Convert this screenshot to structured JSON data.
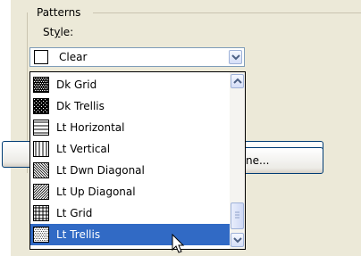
{
  "group": {
    "title": "Patterns"
  },
  "style": {
    "label_prefix": "St",
    "label_accel": "y",
    "label_suffix": "le:"
  },
  "combo": {
    "value": "Clear",
    "swatch": "clear"
  },
  "background_button": {
    "label": "ne..."
  },
  "dropdown": {
    "items": [
      {
        "label": "Dk Grid",
        "pattern": "dk-grid"
      },
      {
        "label": "Dk Trellis",
        "pattern": "dk-trellis"
      },
      {
        "label": "Lt Horizontal",
        "pattern": "lt-horizontal"
      },
      {
        "label": "Lt Vertical",
        "pattern": "lt-vertical"
      },
      {
        "label": "Lt Dwn Diagonal",
        "pattern": "lt-dwn-diagonal"
      },
      {
        "label": "Lt Up Diagonal",
        "pattern": "lt-up-diagonal"
      },
      {
        "label": "Lt Grid",
        "pattern": "lt-grid"
      },
      {
        "label": "Lt Trellis",
        "pattern": "lt-trellis"
      }
    ],
    "selected": "Lt Trellis"
  },
  "colors": {
    "selection": "#316ac5",
    "panel": "#ece9d8",
    "border": "#7f9db9"
  }
}
